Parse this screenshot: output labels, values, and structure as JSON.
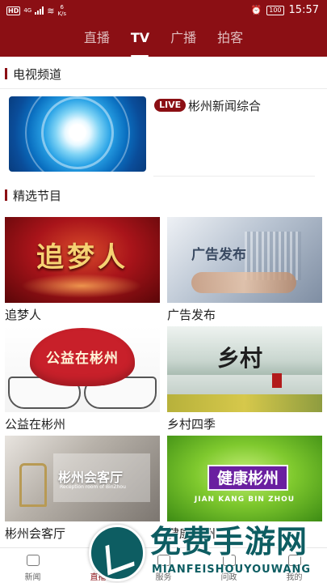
{
  "status_bar": {
    "hd": "HD",
    "network": "4G",
    "speed_value": "6",
    "speed_unit": "K/s",
    "battery": "100",
    "time": "15:57"
  },
  "top_nav": {
    "tabs": [
      {
        "label": "直播",
        "active": false
      },
      {
        "label": "TV",
        "active": true
      },
      {
        "label": "广播",
        "active": false
      },
      {
        "label": "拍客",
        "active": false
      }
    ]
  },
  "tv_section": {
    "title": "电视频道",
    "channel": {
      "badge": "LIVE",
      "name": "彬州新闻综合"
    }
  },
  "featured_section": {
    "title": "精选节目",
    "programs": [
      {
        "label": "追梦人",
        "art_text": "追梦人"
      },
      {
        "label": "广告发布",
        "art_text": "广告发布"
      },
      {
        "label": "公益在彬州",
        "art_text": "公益在彬州"
      },
      {
        "label": "乡村四季",
        "art_text": "乡村"
      },
      {
        "label": "彬州会客厅",
        "art_text": "彬州会客厅",
        "art_sub": "Reception room of BinZhou"
      },
      {
        "label": "健康彬州",
        "art_text": "健康彬州",
        "art_sub": "JIAN KANG BIN ZHOU"
      }
    ]
  },
  "bottom_nav": {
    "items": [
      {
        "label": "新闻",
        "icon": "news-icon",
        "active": false
      },
      {
        "label": "直播",
        "icon": "live-tv-icon",
        "active": true
      },
      {
        "label": "服务",
        "icon": "service-icon",
        "active": false
      },
      {
        "label": "问政",
        "icon": "compass-icon",
        "active": false
      },
      {
        "label": "我的",
        "icon": "user-icon",
        "active": false
      }
    ]
  },
  "watermark": {
    "text": "免费手游网",
    "sub": "MIANFEISHOUYOUWANG"
  },
  "colors": {
    "brand": "#8b0f14",
    "watermark": "#0d5d62"
  }
}
